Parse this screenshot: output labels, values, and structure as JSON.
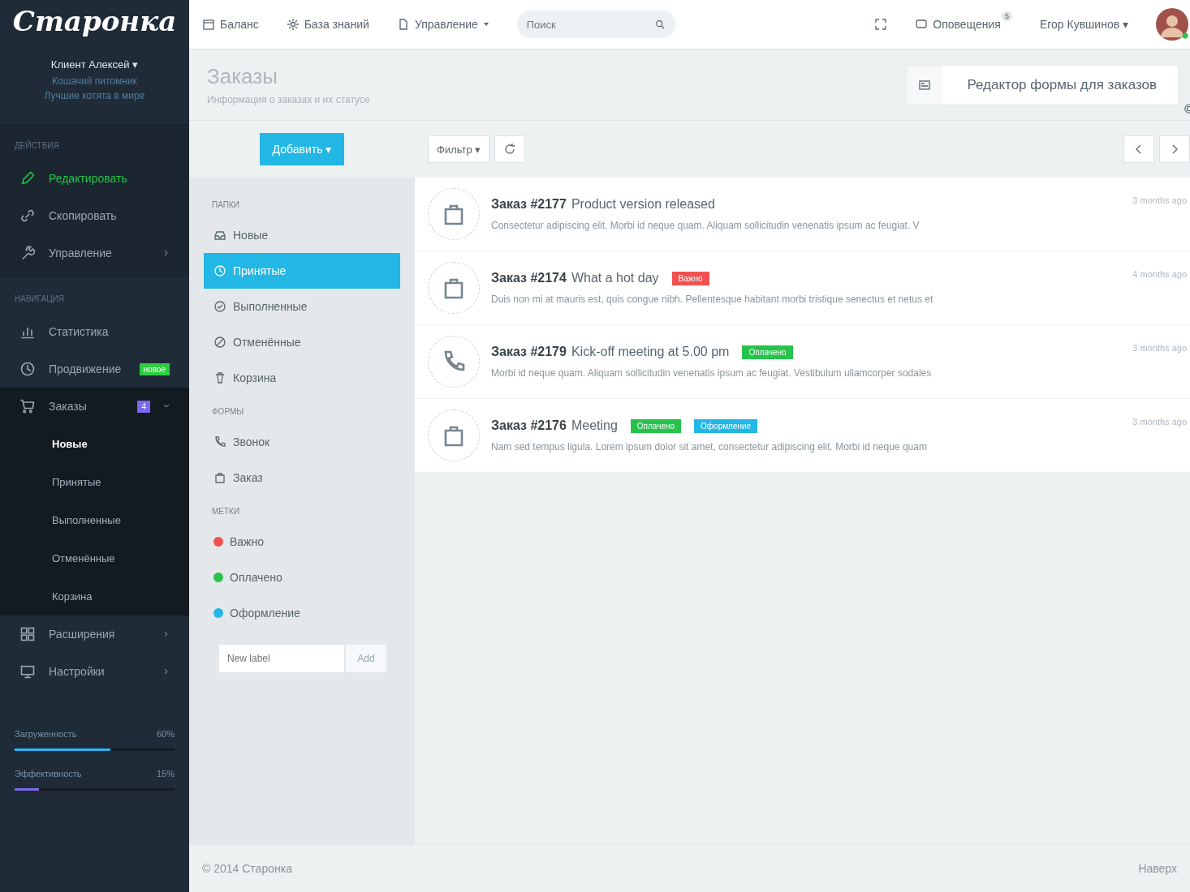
{
  "sidebar": {
    "logo": "Старонка",
    "user": {
      "name": "Клиент Алексей ▾",
      "lines": [
        "Кошачий питомник",
        "Лучшие котята в мире"
      ]
    },
    "sections": [
      {
        "title": "ДЕЙСТВИЯ",
        "items": [
          {
            "label": "Редактировать",
            "highlighted": true,
            "arrow": false,
            "expanded": false
          },
          {
            "label": "Скопировать",
            "highlighted": false,
            "arrow": false,
            "expanded": false
          },
          {
            "label": "Управление",
            "highlighted": false,
            "arrow": true,
            "expanded": false
          }
        ]
      },
      {
        "title": "НАВИГАЦИЯ",
        "items": [
          {
            "label": "Статистика",
            "highlighted": false,
            "arrow": false,
            "expanded": false
          },
          {
            "label": "Продвижение",
            "highlighted": false,
            "arrow": false,
            "expanded": false,
            "badge": {
              "text": "новое",
              "color": "#2ecc40"
            }
          },
          {
            "label": "Заказы",
            "highlighted": false,
            "arrow": true,
            "expanded": true,
            "badge": {
              "text": "4",
              "color": "#7b68ee"
            },
            "children": [
              {
                "label": "Новые",
                "selected": true
              },
              {
                "label": "Принятые",
                "selected": false
              },
              {
                "label": "Выполненные",
                "selected": false
              },
              {
                "label": "Отменённые",
                "selected": false
              },
              {
                "label": "Корзина",
                "selected": false
              }
            ]
          },
          {
            "label": "Расширения",
            "highlighted": false,
            "arrow": true,
            "expanded": false
          },
          {
            "label": "Настройки",
            "highlighted": false,
            "arrow": true,
            "expanded": false
          }
        ]
      }
    ],
    "meters": [
      {
        "label": "Загруженность",
        "reading": "60%",
        "level": 0.6,
        "color": "#29b6f6"
      },
      {
        "label": "Эффективность",
        "reading": "15%",
        "level": 0.15,
        "color": "#7b68ee"
      }
    ]
  },
  "topbar": {
    "links": [
      {
        "label": "Баланс",
        "dropdown": false
      },
      {
        "label": "База знаний",
        "dropdown": false
      },
      {
        "label": "Управление",
        "dropdown": true
      }
    ],
    "search": {
      "placeholder": "Поиск"
    },
    "notifications": {
      "label": "Оповещения",
      "count": "5"
    },
    "user": "Егор Кувшинов ▾"
  },
  "header": {
    "title": "Заказы",
    "subtitle": "Информация о заказах и их статусе",
    "form_editor": "Редактор формы для заказов"
  },
  "mailbox": {
    "add_button": "Добавить ▾",
    "groups": [
      {
        "title": "ПАПКИ",
        "items": [
          {
            "label": "Новые",
            "selected": false
          },
          {
            "label": "Принятые",
            "selected": true
          },
          {
            "label": "Выполненные",
            "selected": false
          },
          {
            "label": "Отменённые",
            "selected": false
          },
          {
            "label": "Корзина",
            "selected": false
          }
        ]
      },
      {
        "title": "ФОРМЫ",
        "items": [
          {
            "label": "Звонок",
            "selected": false
          },
          {
            "label": "Заказ",
            "selected": false
          }
        ]
      }
    ],
    "labels_title": "МЕТКИ",
    "labels": [
      {
        "label": "Важно",
        "color": "#f05050"
      },
      {
        "label": "Оплачено",
        "color": "#27c24c"
      },
      {
        "label": "Оформление",
        "color": "#23b7e5"
      }
    ],
    "new_label": {
      "placeholder": "New label",
      "button": "Add"
    }
  },
  "toolbar": {
    "filter": "Фильтр ▾"
  },
  "orders": [
    {
      "kind": "order",
      "number": "Заказ #2177",
      "title": "Product version released",
      "text": "Consectetur adipiscing elit. Morbi id neque quam. Aliquam sollicitudin venenatis ipsum ac feugiat. V",
      "time": "3 months ago"
    },
    {
      "kind": "order",
      "number": "Заказ #2174",
      "title": "What a hot day",
      "tags": [
        {
          "label": "Важно",
          "color": "#f05050"
        }
      ],
      "text": "Duis non mi at mauris est, quis congue nibh. Pellentesque habitant morbi tristique senectus et netus et",
      "time": "4 months ago"
    },
    {
      "kind": "call",
      "number": "Заказ #2179",
      "title": "Kick-off meeting at 5.00 pm",
      "tags": [
        {
          "label": "Оплачено",
          "color": "#27c24c"
        }
      ],
      "text": "Morbi id neque quam. Aliquam sollicitudin venenatis ipsum ac feugiat. Vestibulum ullamcorper sodales",
      "time": "3 months ago"
    },
    {
      "kind": "order",
      "number": "Заказ #2176",
      "title": "Meeting",
      "tags": [
        {
          "label": "Оплачено",
          "color": "#27c24c"
        },
        {
          "label": "Оформление",
          "color": "#23b7e5"
        }
      ],
      "text": "Nam sed tempus ligula. Lorem ipsum dolor sit amet, consectetur adipiscing elit. Morbi id neque quam",
      "time": "3 months ago"
    }
  ],
  "footer": {
    "copyright": "© 2014 Старонка",
    "top_link": "Наверх"
  }
}
